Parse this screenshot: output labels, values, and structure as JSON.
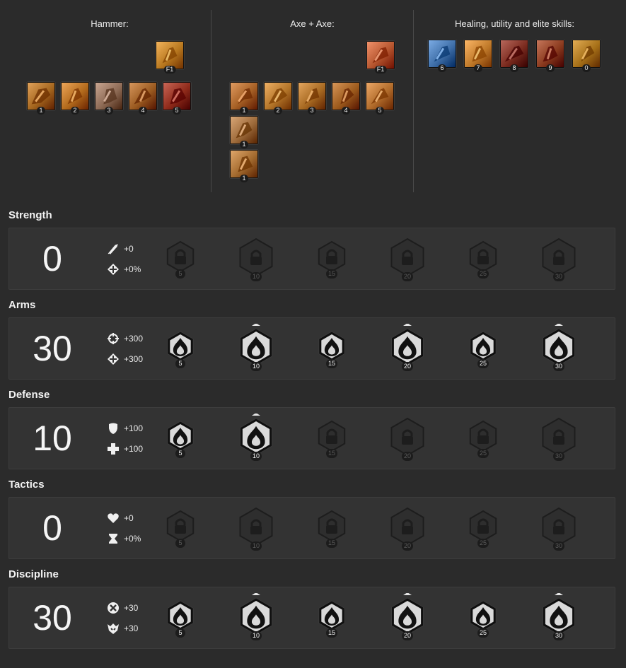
{
  "weapon_sets": [
    {
      "title": "Hammer:",
      "profession_skill": {
        "key": "F1",
        "icon": "burst-skill-icon",
        "color": "#b8781f"
      },
      "skills": [
        {
          "key": "1",
          "icon": "hammer-swing-icon",
          "color": "#a5661e"
        },
        {
          "key": "2",
          "icon": "fierce-blow-icon",
          "color": "#b26a1c"
        },
        {
          "key": "3",
          "icon": "hammer-shock-icon",
          "color": "#8d6a55"
        },
        {
          "key": "4",
          "icon": "staggering-blow-icon",
          "color": "#9a5a20"
        },
        {
          "key": "5",
          "icon": "backbreaker-icon",
          "color": "#8e2a1a"
        }
      ],
      "extra_skills": []
    },
    {
      "title": "Axe + Axe:",
      "profession_skill": {
        "key": "F1",
        "icon": "eviscerate-icon",
        "color": "#b5552e"
      },
      "skills": [
        {
          "key": "1",
          "icon": "cyclone-axe-icon",
          "color": "#a55f24"
        },
        {
          "key": "2",
          "icon": "throw-axe-icon",
          "color": "#b37428"
        },
        {
          "key": "3",
          "icon": "dual-strike-icon",
          "color": "#a86a22"
        },
        {
          "key": "4",
          "icon": "whirling-axe-icon",
          "color": "#9c5a1c"
        },
        {
          "key": "5",
          "icon": "axe-chain-icon",
          "color": "#b06b2a"
        }
      ],
      "extra_skills": [
        {
          "key": "1",
          "icon": "chop-icon",
          "color": "#9d6a3a"
        },
        {
          "key": "1",
          "icon": "double-chop-icon",
          "color": "#a36a2e"
        }
      ]
    },
    {
      "title": "Healing, utility and elite skills:",
      "profession_skill": null,
      "skills": [
        {
          "key": "6",
          "icon": "healing-signet-icon",
          "color": "#3f6fa8"
        },
        {
          "key": "7",
          "icon": "banner-icon",
          "color": "#c07a2a"
        },
        {
          "key": "8",
          "icon": "frenzy-icon",
          "color": "#7b2b1f"
        },
        {
          "key": "9",
          "icon": "bulls-charge-icon",
          "color": "#8a3a1e"
        },
        {
          "key": "0",
          "icon": "signet-of-rage-icon",
          "color": "#a67018"
        }
      ],
      "extra_skills": []
    }
  ],
  "trait_lines": [
    {
      "name": "Strength",
      "points": "0",
      "stats": [
        {
          "icon": "power-icon",
          "value": "+0"
        },
        {
          "icon": "condition-damage-icon",
          "value": "+0%"
        }
      ],
      "traits": [
        {
          "tier": "5",
          "state": "locked",
          "major": false
        },
        {
          "tier": "10",
          "state": "locked",
          "major": true
        },
        {
          "tier": "15",
          "state": "locked",
          "major": false
        },
        {
          "tier": "20",
          "state": "locked",
          "major": true
        },
        {
          "tier": "25",
          "state": "locked",
          "major": false
        },
        {
          "tier": "30",
          "state": "locked",
          "major": true
        }
      ]
    },
    {
      "name": "Arms",
      "points": "30",
      "stats": [
        {
          "icon": "precision-icon",
          "value": "+300"
        },
        {
          "icon": "condition-damage-icon",
          "value": "+300"
        }
      ],
      "traits": [
        {
          "tier": "5",
          "state": "active",
          "major": false
        },
        {
          "tier": "10",
          "state": "active",
          "major": true
        },
        {
          "tier": "15",
          "state": "active",
          "major": false
        },
        {
          "tier": "20",
          "state": "active",
          "major": true
        },
        {
          "tier": "25",
          "state": "active",
          "major": false
        },
        {
          "tier": "30",
          "state": "active",
          "major": true
        }
      ]
    },
    {
      "name": "Defense",
      "points": "10",
      "stats": [
        {
          "icon": "toughness-icon",
          "value": "+100"
        },
        {
          "icon": "healing-power-icon",
          "value": "+100"
        }
      ],
      "traits": [
        {
          "tier": "5",
          "state": "active",
          "major": false
        },
        {
          "tier": "10",
          "state": "active",
          "major": true
        },
        {
          "tier": "15",
          "state": "locked",
          "major": false
        },
        {
          "tier": "20",
          "state": "locked",
          "major": true
        },
        {
          "tier": "25",
          "state": "locked",
          "major": false
        },
        {
          "tier": "30",
          "state": "locked",
          "major": true
        }
      ]
    },
    {
      "name": "Tactics",
      "points": "0",
      "stats": [
        {
          "icon": "vitality-icon",
          "value": "+0"
        },
        {
          "icon": "boon-duration-icon",
          "value": "+0%"
        }
      ],
      "traits": [
        {
          "tier": "5",
          "state": "locked",
          "major": false
        },
        {
          "tier": "10",
          "state": "locked",
          "major": true
        },
        {
          "tier": "15",
          "state": "locked",
          "major": false
        },
        {
          "tier": "20",
          "state": "locked",
          "major": true
        },
        {
          "tier": "25",
          "state": "locked",
          "major": false
        },
        {
          "tier": "30",
          "state": "locked",
          "major": true
        }
      ]
    },
    {
      "name": "Discipline",
      "points": "30",
      "stats": [
        {
          "icon": "critical-damage-icon",
          "value": "+30"
        },
        {
          "icon": "adrenaline-icon",
          "value": "+30"
        }
      ],
      "traits": [
        {
          "tier": "5",
          "state": "active",
          "major": false
        },
        {
          "tier": "10",
          "state": "active",
          "major": true
        },
        {
          "tier": "15",
          "state": "active",
          "major": false
        },
        {
          "tier": "20",
          "state": "active",
          "major": true
        },
        {
          "tier": "25",
          "state": "active",
          "major": false
        },
        {
          "tier": "30",
          "state": "active",
          "major": true
        }
      ]
    }
  ]
}
